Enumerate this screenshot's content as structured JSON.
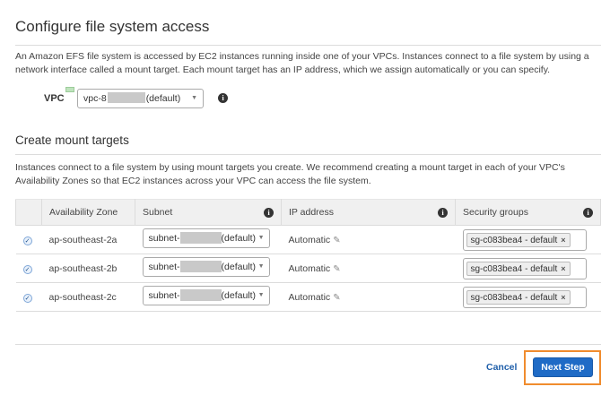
{
  "page": {
    "title": "Configure file system access",
    "description": "An Amazon EFS file system is accessed by EC2 instances running inside one of your VPCs. Instances connect to a file system by using a network interface called a mount target. Each mount target has an IP address, which we assign automatically or you can specify."
  },
  "vpc": {
    "label": "VPC",
    "select_prefix": "vpc-8",
    "select_suffix": "(default)",
    "tag": "VPC",
    "info_icon": "info-icon"
  },
  "mount_targets": {
    "title": "Create mount targets",
    "description": "Instances connect to a file system by using mount targets you create. We recommend creating a mount target in each of your VPC's Availability Zones so that EC2 instances across your VPC can access the file system.",
    "columns": [
      "Availability Zone",
      "Subnet",
      "IP address",
      "Security groups"
    ],
    "rows": [
      {
        "zone": "ap-southeast-2a",
        "subnet_prefix": "subnet-",
        "subnet_suffix": "(default)",
        "ip": "Automatic",
        "sg": "sg-c083bea4 - default"
      },
      {
        "zone": "ap-southeast-2b",
        "subnet_prefix": "subnet-",
        "subnet_suffix": "(default)",
        "ip": "Automatic",
        "sg": "sg-c083bea4 - default"
      },
      {
        "zone": "ap-southeast-2c",
        "subnet_prefix": "subnet-",
        "subnet_suffix": "(default)",
        "ip": "Automatic",
        "sg": "sg-c083bea4 - default"
      }
    ]
  },
  "footer": {
    "cancel_label": "Cancel",
    "next_label": "Next Step"
  },
  "colors": {
    "primary_button": "#1f6bc6",
    "highlight": "#f08c2e",
    "link": "#1f5faa"
  }
}
